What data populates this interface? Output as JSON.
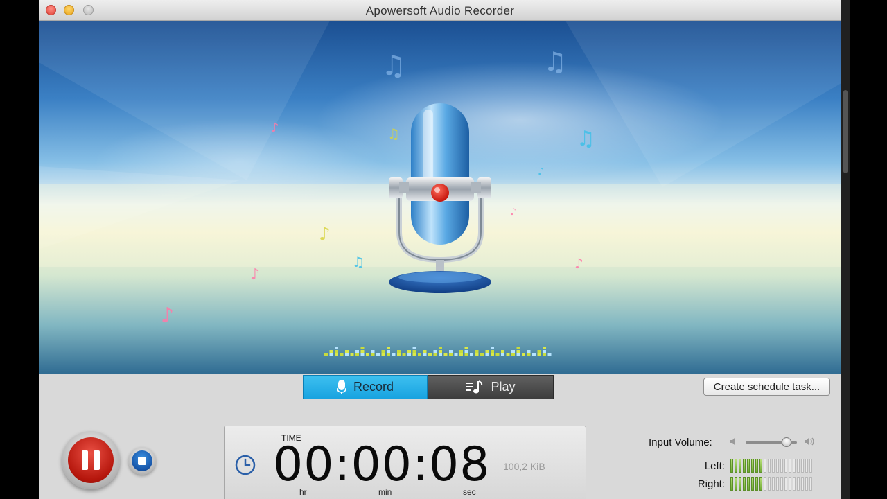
{
  "window": {
    "title": "Apowersoft Audio Recorder"
  },
  "tabs": {
    "record_label": "Record",
    "play_label": "Play"
  },
  "toolbar": {
    "schedule_label": "Create schedule task..."
  },
  "timer": {
    "heading": "TIME",
    "display": "00:00:08",
    "hr_label": "hr",
    "min_label": "min",
    "sec_label": "sec",
    "file_size": "100,2 KiB"
  },
  "volume": {
    "label": "Input Volume:",
    "level": 0.8
  },
  "meters": {
    "left_label": "Left:",
    "right_label": "Right:",
    "total_segments": 20,
    "left_active": 8,
    "right_active": 8
  },
  "colors": {
    "record_tab": "#18a3e0",
    "play_tab": "#4a4a4a",
    "pause_red": "#b5160c",
    "stop_blue": "#1755a8",
    "meter_green": "#6ea832"
  },
  "icons": {
    "record_tab": "microphone-icon",
    "play_tab": "playlist-music-icon",
    "pause": "pause-icon",
    "stop": "stop-icon",
    "timer": "clock-icon",
    "volume_low": "speaker-low-icon",
    "volume_high": "speaker-high-icon"
  }
}
